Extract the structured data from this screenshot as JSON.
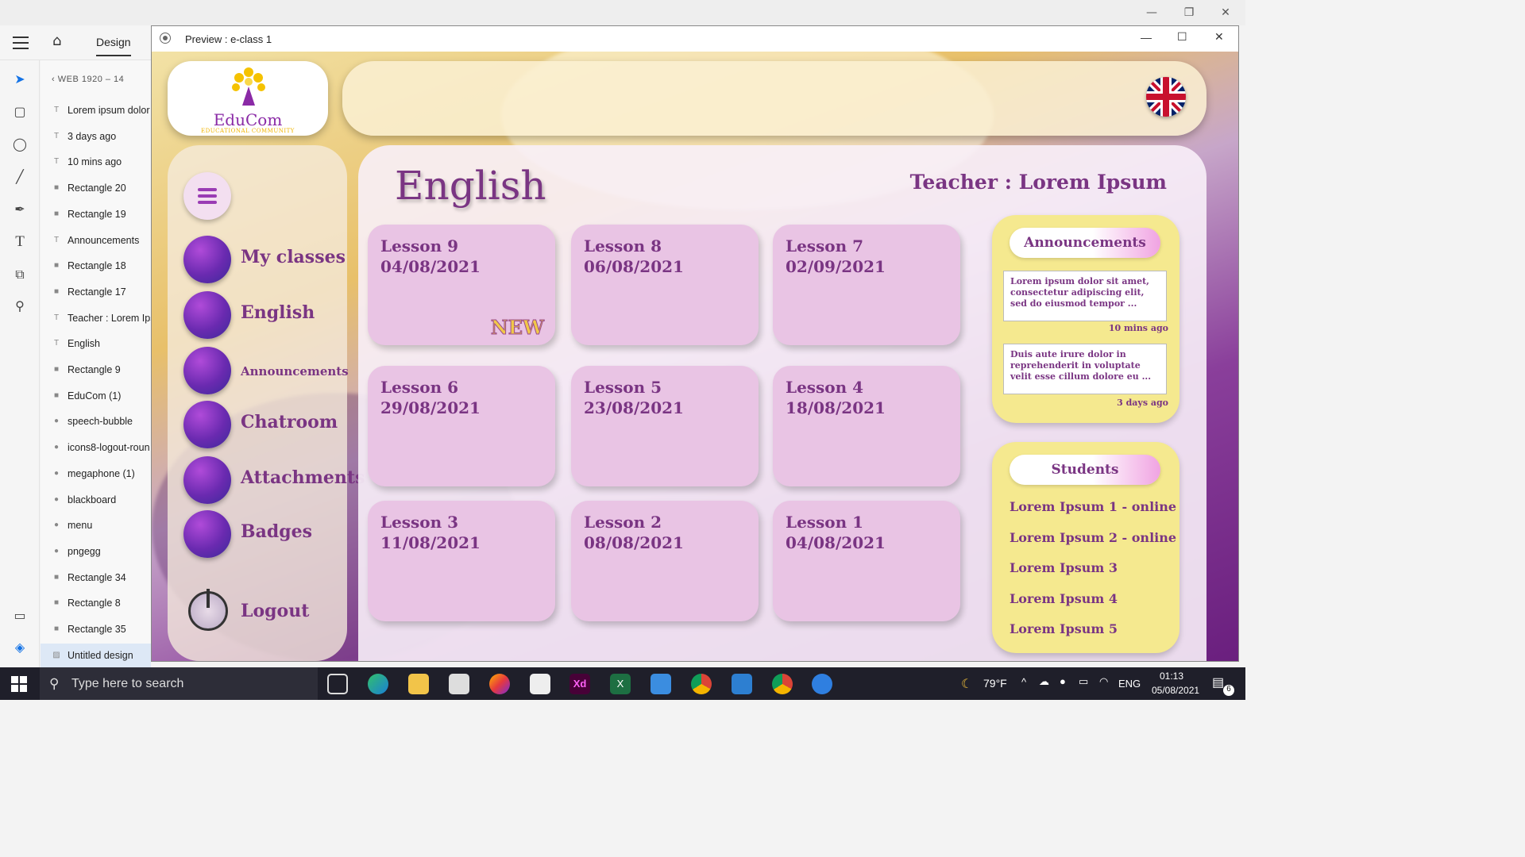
{
  "window_controls": {
    "minimize": "—",
    "restore": "❐",
    "close": "✕"
  },
  "xd": {
    "tab_design": "Design",
    "artboard": "WEB 1920 – 14",
    "layers": [
      {
        "icon": "text",
        "label": "Lorem ipsum dolor"
      },
      {
        "icon": "text",
        "label": "3 days ago"
      },
      {
        "icon": "text",
        "label": "10 mins ago"
      },
      {
        "icon": "rect",
        "label": "Rectangle 20"
      },
      {
        "icon": "rect",
        "label": "Rectangle 19"
      },
      {
        "icon": "text",
        "label": "Announcements"
      },
      {
        "icon": "rect",
        "label": "Rectangle 18"
      },
      {
        "icon": "rect",
        "label": "Rectangle 17"
      },
      {
        "icon": "text",
        "label": "Teacher : Lorem Ipsu"
      },
      {
        "icon": "text",
        "label": "English"
      },
      {
        "icon": "rect",
        "label": "Rectangle 9"
      },
      {
        "icon": "rect",
        "label": "EduCom (1)"
      },
      {
        "icon": "circle",
        "label": "speech-bubble"
      },
      {
        "icon": "circle",
        "label": "icons8-logout-roun"
      },
      {
        "icon": "circle",
        "label": "megaphone (1)"
      },
      {
        "icon": "circle",
        "label": "blackboard"
      },
      {
        "icon": "circle",
        "label": "menu"
      },
      {
        "icon": "circle",
        "label": "pngegg"
      },
      {
        "icon": "rect",
        "label": "Rectangle 34"
      },
      {
        "icon": "rect",
        "label": "Rectangle 8"
      },
      {
        "icon": "rect",
        "label": "Rectangle 35"
      },
      {
        "icon": "image",
        "label": "Untitled design"
      }
    ]
  },
  "preview": {
    "title": "Preview : e-class 1",
    "logo": {
      "name": "EduCom",
      "tagline": "EDUCATIONAL COMMUNITY"
    },
    "subject": "English",
    "teacher": "Teacher : Lorem Ipsum",
    "nav": [
      {
        "label": "My classes",
        "icon": "blackboard-icon"
      },
      {
        "label": "English",
        "icon": "book-icon"
      },
      {
        "label": "Announcements",
        "icon": "megaphone-icon"
      },
      {
        "label": "Chatroom",
        "icon": "speech-bubble-icon"
      },
      {
        "label": "Attachments",
        "icon": "paperclip-icon"
      },
      {
        "label": "Badges",
        "icon": "graduation-cap-icon"
      }
    ],
    "logout": "Logout",
    "lessons": [
      {
        "title": "Lesson 9",
        "date": "04/08/2021",
        "badge": "NEW"
      },
      {
        "title": "Lesson 8",
        "date": "06/08/2021"
      },
      {
        "title": "Lesson 7",
        "date": "02/09/2021"
      },
      {
        "title": "Lesson 6",
        "date": "29/08/2021"
      },
      {
        "title": "Lesson 5",
        "date": "23/08/2021"
      },
      {
        "title": "Lesson 4",
        "date": "18/08/2021"
      },
      {
        "title": "Lesson 3",
        "date": "11/08/2021"
      },
      {
        "title": "Lesson 2",
        "date": "08/08/2021"
      },
      {
        "title": "Lesson 1",
        "date": "04/08/2021"
      }
    ],
    "announcements": {
      "title": "Announcements",
      "items": [
        {
          "text": "Lorem ipsum dolor sit amet, consectetur adipiscing elit, sed do eiusmod tempor ...",
          "time": "10 mins ago"
        },
        {
          "text": "Duis aute irure dolor in reprehenderit in voluptate velit esse cillum dolore eu ...",
          "time": "3 days ago"
        }
      ]
    },
    "students": {
      "title": "Students",
      "items": [
        "Lorem Ipsum 1 - online",
        "Lorem Ipsum 2 - online",
        "Lorem Ipsum 3",
        "Lorem Ipsum 4",
        "Lorem Ipsum 5"
      ]
    },
    "colors": {
      "accent": "#7a3583",
      "panel": "#f5e98f",
      "lesson_card": "#e9c4e4"
    }
  },
  "taskbar": {
    "search_placeholder": "Type here to search",
    "weather": "79°F",
    "language": "ENG",
    "time": "01:13",
    "date": "05/08/2021",
    "notification_count": "6"
  }
}
